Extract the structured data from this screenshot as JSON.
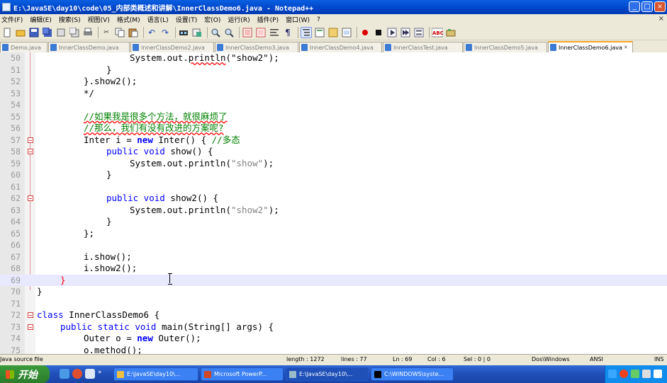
{
  "window": {
    "title": "E:\\JavaSE\\day10\\code\\05_内部类概述和讲解\\InnerClassDemo6.java - Notepad++",
    "buttons": [
      "_",
      "□",
      "×"
    ]
  },
  "menu": {
    "items": [
      "文件(F)",
      "编辑(E)",
      "搜索(S)",
      "视图(V)",
      "格式(M)",
      "语言(L)",
      "设置(T)",
      "宏(O)",
      "运行(R)",
      "插件(P)",
      "窗口(W)",
      "?"
    ],
    "close": "×"
  },
  "toolbar": {
    "icons": [
      "new-file-icon",
      "open-file-icon",
      "save-icon",
      "save-all-icon",
      "close-icon",
      "close-all-icon",
      "print-icon",
      "cut-icon",
      "copy-icon",
      "paste-icon",
      "undo-icon",
      "redo-icon",
      "find-icon",
      "replace-icon",
      "zoom-in-icon",
      "zoom-out-icon",
      "sync-v-icon",
      "sync-h-icon",
      "word-wrap-icon",
      "show-all-chars-icon",
      "indent-guide-icon",
      "user-lang-icon",
      "doc-map-icon",
      "function-list-icon",
      "record-macro-icon",
      "stop-macro-icon",
      "play-macro-icon",
      "run-macro-multiple-icon",
      "save-macro-icon",
      "spell-check-icon",
      "plugin-icon"
    ]
  },
  "tabs": [
    {
      "label": "Demo.java"
    },
    {
      "label": "InnerClassDemo.java"
    },
    {
      "label": "InnerClassDemo2.java"
    },
    {
      "label": "InnerClassDemo3.java"
    },
    {
      "label": "InnerClassDemo4.java"
    },
    {
      "label": "InnerClassTest.java"
    },
    {
      "label": "InnerClassDemo5.java"
    },
    {
      "label": "InnerClassDemo6.java",
      "active": true
    }
  ],
  "editor": {
    "current_line": 69,
    "lines": [
      {
        "n": "50"
      },
      {
        "n": "51"
      },
      {
        "n": "52"
      },
      {
        "n": "53"
      },
      {
        "n": "54"
      },
      {
        "n": "55"
      },
      {
        "n": "56"
      },
      {
        "n": "57"
      },
      {
        "n": "58"
      },
      {
        "n": "59"
      },
      {
        "n": "60"
      },
      {
        "n": "61"
      },
      {
        "n": "62"
      },
      {
        "n": "63"
      },
      {
        "n": "64"
      },
      {
        "n": "65"
      },
      {
        "n": "66"
      },
      {
        "n": "67"
      },
      {
        "n": "68"
      },
      {
        "n": "69"
      },
      {
        "n": "70"
      },
      {
        "n": "71"
      },
      {
        "n": "72"
      },
      {
        "n": "73"
      },
      {
        "n": "74"
      },
      {
        "n": "75"
      }
    ],
    "code": {
      "l50_a": "System.out.",
      "l50_b": "println",
      "l50_c": "(\"show2\");",
      "l51": "}",
      "l52": "}.show2();",
      "l53": "*/",
      "l55": "//如果我是很多个方法，就很麻烦了",
      "l56": "//那么，我们有没有改进的方案呢?",
      "l57_a": "Inter i = ",
      "l57_new": "new",
      "l57_b": " Inter() { ",
      "l57_cm": "//多态",
      "l58_kw": "public void",
      "l58_b": " show() {",
      "l59_a": "System.out.println(",
      "l59_s": "\"show\"",
      "l59_b": ");",
      "l60": "}",
      "l62_kw": "public void",
      "l62_b": " show2() {",
      "l63_a": "System.out.println(",
      "l63_s": "\"show2\"",
      "l63_b": ");",
      "l64": "}",
      "l65": "};",
      "l67": "i.show();",
      "l68": "i.show2();",
      "l69": "}",
      "l70": "}",
      "l72_kw": "class",
      "l72_b": " InnerClassDemo6 {",
      "l73_kw": "public static void",
      "l73_b": " main(String[] args) {",
      "l74_a": "Outer o = ",
      "l74_new": "new",
      "l74_b": " Outer();",
      "l75": "o.method();"
    }
  },
  "status": {
    "filetype": "Java source file",
    "length": "length : 1272",
    "lines": "lines : 77",
    "ln": "Ln : 69",
    "col": "Col : 6",
    "sel": "Sel : 0 | 0",
    "eol": "Dos\\Windows",
    "encoding": "ANSI",
    "ins": "INS"
  },
  "taskbar": {
    "start": "开始",
    "tasks": [
      {
        "label": "E:\\JavaSE\\day10\\..."
      },
      {
        "label": "Microsoft PowerP..."
      },
      {
        "label": "E:\\JavaSE\\day10\\..."
      },
      {
        "label": "C:\\WINDOWS\\syste..."
      }
    ]
  }
}
